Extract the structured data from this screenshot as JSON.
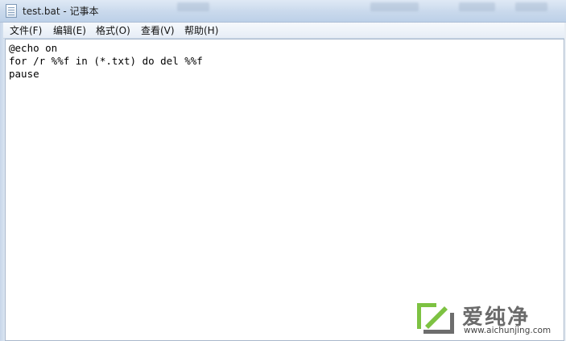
{
  "window": {
    "title": "test.bat - 记事本",
    "icon": "notepad-icon"
  },
  "menu": {
    "items": [
      {
        "label": "文件(F)"
      },
      {
        "label": "编辑(E)"
      },
      {
        "label": "格式(O)"
      },
      {
        "label": "查看(V)"
      },
      {
        "label": "帮助(H)"
      }
    ]
  },
  "editor": {
    "content": "@echo on\nfor /r %%f in (*.txt) do del %%f\npause"
  },
  "watermark": {
    "brand": "爱纯净",
    "url": "www.aichunjing.com",
    "icon": "aichunjing-logo",
    "accent": "#7dc242"
  },
  "colors": {
    "titlebar": "#c9d9ec",
    "menubar": "#e6edf6",
    "editor_bg": "#ffffff"
  }
}
